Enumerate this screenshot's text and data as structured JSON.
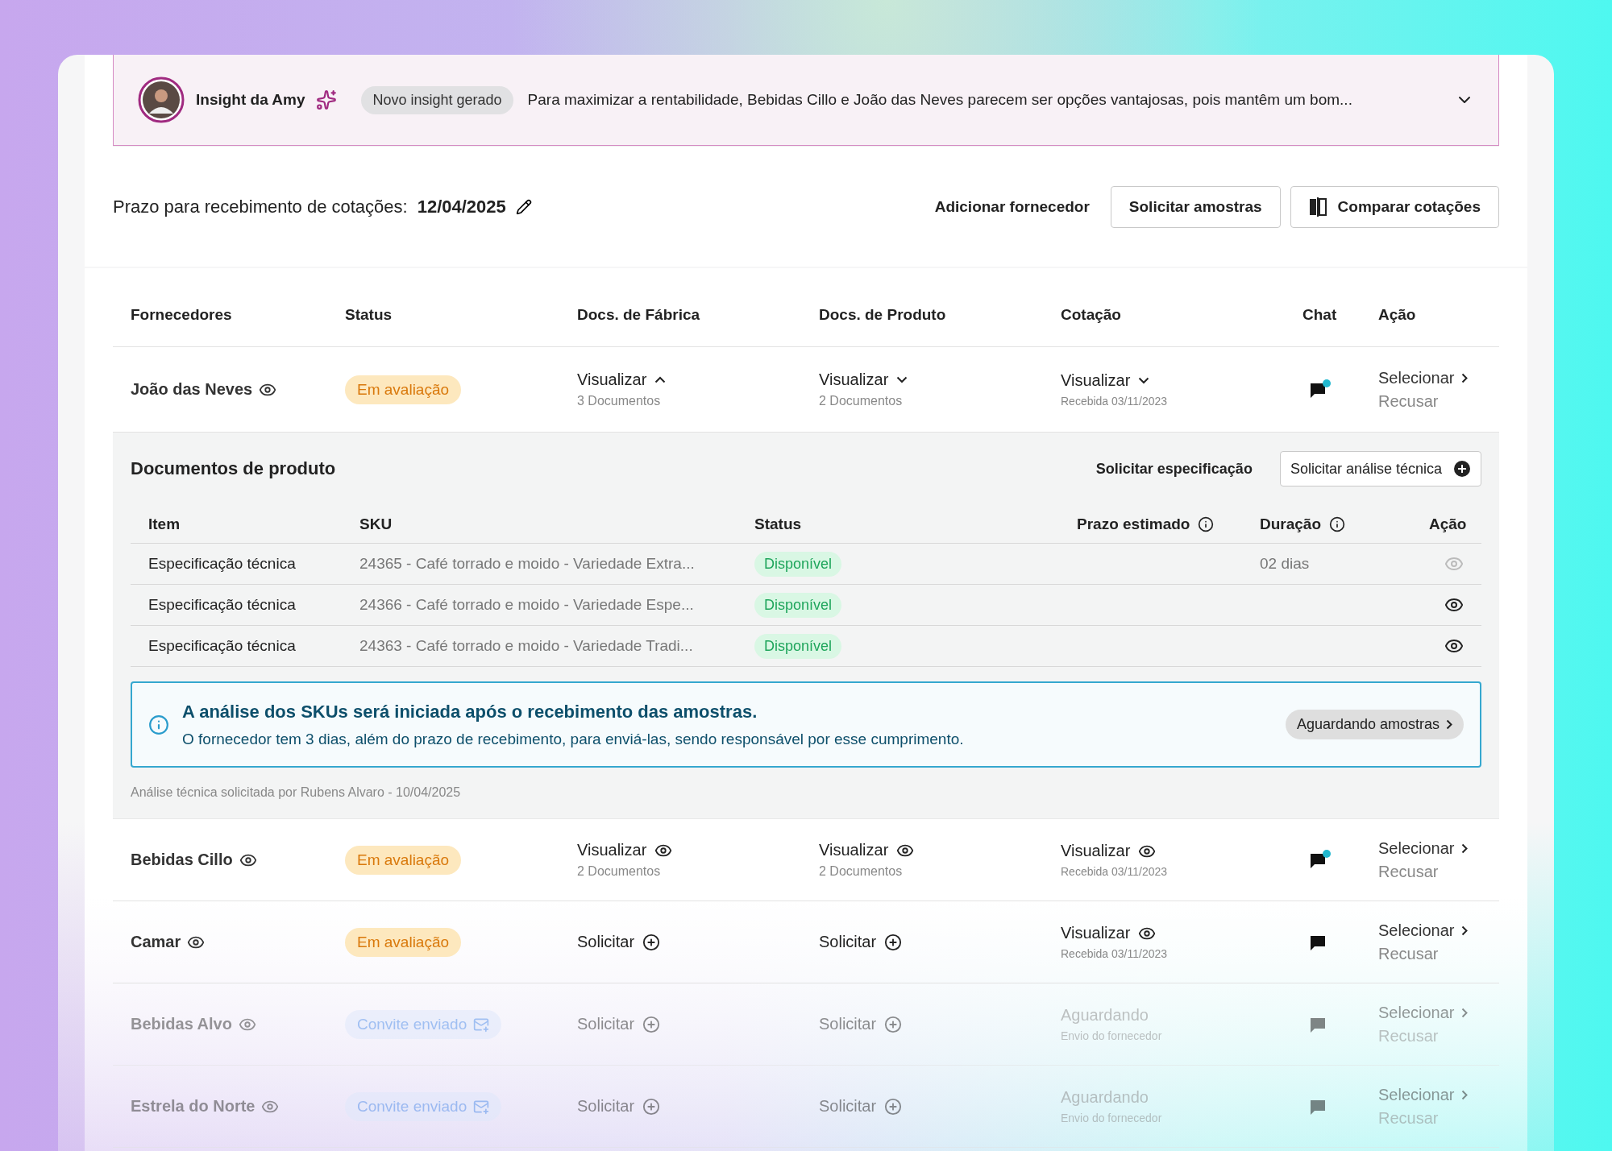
{
  "insight": {
    "title": "Insight da Amy",
    "badge": "Novo insight gerado",
    "text": "Para maximizar a rentabilidade, Bebidas Cillo e João das Neves parecem ser opções vantajosas, pois mantêm um bom...",
    "expanded": false
  },
  "deadline": {
    "label": "Prazo para recebimento de cotações:",
    "date": "12/04/2025"
  },
  "actions": [
    {
      "kind": "link",
      "label": "Adicionar fornecedor"
    },
    {
      "kind": "outline",
      "label": "Solicitar amostras"
    },
    {
      "kind": "compare",
      "label": "Comparar cotações"
    }
  ],
  "columns": [
    "Fornecedores",
    "Status",
    "Docs. de Fábrica",
    "Docs. de Produto",
    "Cotação",
    "Chat",
    "Ação"
  ],
  "suppliers": [
    {
      "name": "João das Neves",
      "muted": false,
      "status": {
        "kind": "evaluation",
        "label": "Em avaliação"
      },
      "factory_docs": {
        "kind": "dropdown",
        "label": "Visualizar",
        "sub": "3 Documentos",
        "expanded": true
      },
      "product_docs": {
        "kind": "dropdown",
        "label": "Visualizar",
        "sub": "2 Documentos",
        "expanded": false
      },
      "quote": {
        "kind": "dropdown",
        "label": "Visualizar",
        "sub": "Recebida 03/11/2023",
        "expanded": false
      },
      "chat_unread": true,
      "select": "Selecionar",
      "refuse": "Recusar",
      "expanded": true
    },
    {
      "name": "Bebidas Cillo",
      "muted": false,
      "status": {
        "kind": "evaluation",
        "label": "Em avaliação"
      },
      "factory_docs": {
        "kind": "view",
        "label": "Visualizar",
        "sub": "2 Documentos"
      },
      "product_docs": {
        "kind": "view",
        "label": "Visualizar",
        "sub": "2 Documentos"
      },
      "quote": {
        "kind": "view",
        "label": "Visualizar",
        "sub": "Recebida 03/11/2023"
      },
      "chat_unread": true,
      "select": "Selecionar",
      "refuse": "Recusar",
      "expanded": false
    },
    {
      "name": "Camar",
      "muted": false,
      "status": {
        "kind": "evaluation",
        "label": "Em avaliação"
      },
      "factory_docs": {
        "kind": "request",
        "label": "Solicitar"
      },
      "product_docs": {
        "kind": "request",
        "label": "Solicitar"
      },
      "quote": {
        "kind": "view",
        "label": "Visualizar",
        "sub": "Recebida 03/11/2023"
      },
      "chat_unread": false,
      "select": "Selecionar",
      "refuse": "Recusar",
      "expanded": false
    },
    {
      "name": "Bebidas Alvo",
      "muted": true,
      "status": {
        "kind": "invite",
        "label": "Convite enviado"
      },
      "factory_docs": {
        "kind": "request",
        "label": "Solicitar"
      },
      "product_docs": {
        "kind": "request",
        "label": "Solicitar"
      },
      "quote": {
        "kind": "waiting",
        "label": "Aguardando",
        "sub": "Envio do fornecedor"
      },
      "chat_unread": false,
      "select": "Selecionar",
      "refuse": "Recusar",
      "expanded": false
    },
    {
      "name": "Estrela do Norte",
      "muted": true,
      "status": {
        "kind": "invite",
        "label": "Convite enviado"
      },
      "factory_docs": {
        "kind": "request",
        "label": "Solicitar"
      },
      "product_docs": {
        "kind": "request",
        "label": "Solicitar"
      },
      "quote": {
        "kind": "waiting",
        "label": "Aguardando",
        "sub": "Envio do fornecedor"
      },
      "chat_unread": false,
      "select": "Selecionar",
      "refuse": "Recusar",
      "expanded": false
    }
  ],
  "detail": {
    "title": "Documentos de produto",
    "link": "Solicitar especificação",
    "button": "Solicitar análise técnica",
    "columns": [
      {
        "label": "Item",
        "info": false
      },
      {
        "label": "SKU",
        "info": false
      },
      {
        "label": "Status",
        "info": false
      },
      {
        "label": "Prazo estimado",
        "info": true
      },
      {
        "label": "Duração",
        "info": true
      },
      {
        "label": "Ação",
        "info": false
      }
    ],
    "rows": [
      {
        "item": "Especificação técnica",
        "sku": "24365 - Café torrado e moido - Variedade Extra...",
        "status": "Disponível",
        "duration": "02 dias",
        "disabled": true
      },
      {
        "item": "Especificação técnica",
        "sku": "24366 - Café torrado e moido - Variedade Espe...",
        "status": "Disponível",
        "disabled": false
      },
      {
        "item": "Especificação técnica",
        "sku": "24363 - Café torrado e moido - Variedade Tradi...",
        "status": "Disponível",
        "disabled": false
      }
    ],
    "notice": {
      "title": "A análise dos SKUs será iniciada após o recebimento das amostras.",
      "text": "O fornecedor tem 3 dias, além do prazo de recebimento, para enviá-las, sendo responsável por esse cumprimento.",
      "badge": "Aguardando amostras"
    },
    "footer": "Análise técnica solicitada por Rubens Alvaro - 10/04/2025"
  }
}
